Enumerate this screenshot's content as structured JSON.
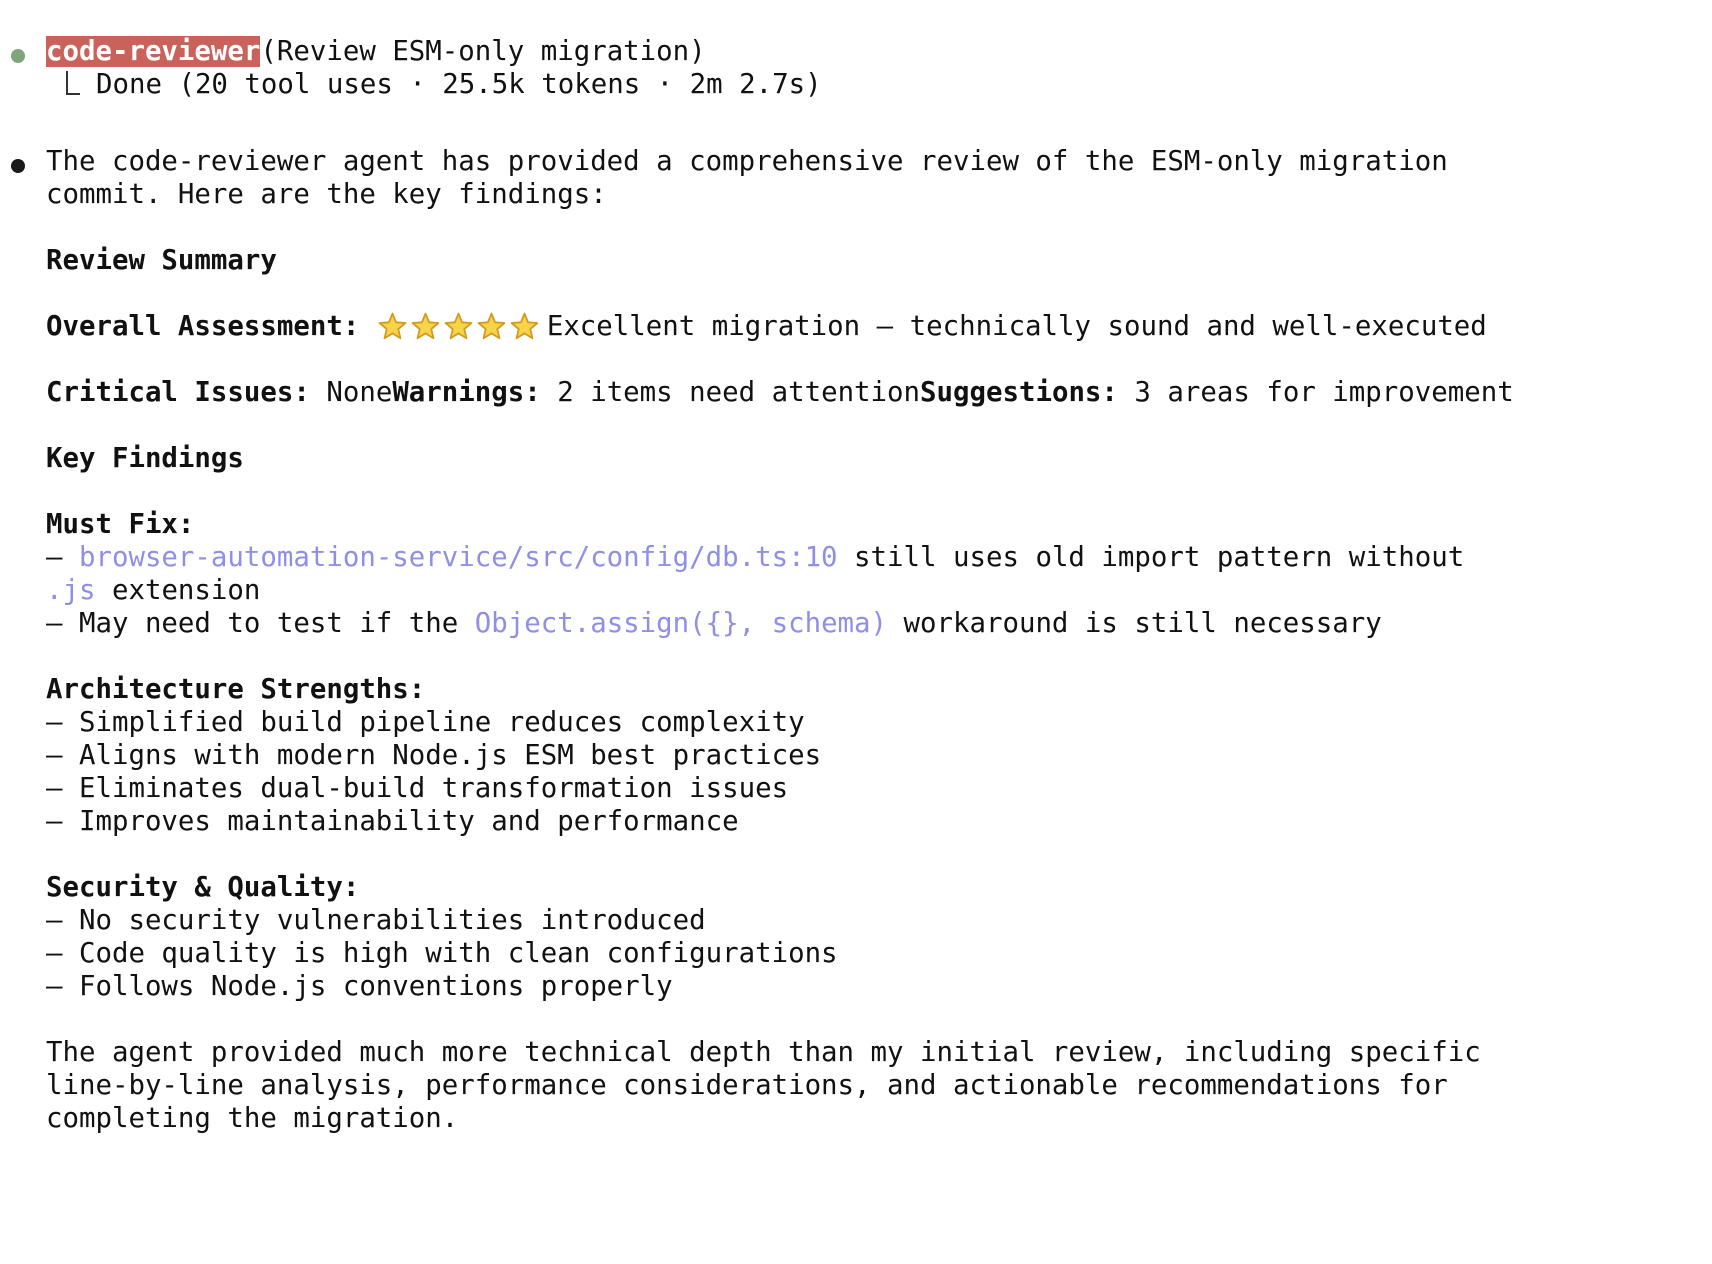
{
  "task": {
    "agent_name": "code-reviewer",
    "description": "(Review ESM-only migration)",
    "status": "Done (20 tool uses · 25.5k tokens · 2m 2.7s)"
  },
  "response": {
    "intro_line1": "The code-reviewer agent has provided a comprehensive review of the ESM-only migration",
    "intro_line2": "commit. Here are the key findings:",
    "review_summary_heading": "Review Summary",
    "overall_label": "Overall Assessment:",
    "overall_rating": 5,
    "overall_max": 5,
    "overall_text": "Excellent migration – technically sound and well-executed",
    "critical_label": "Critical Issues:",
    "critical_value": " None",
    "warnings_label": "Warnings:",
    "warnings_value": " 2 items need attention",
    "suggestions_label": "Suggestions:",
    "suggestions_value": " 3 areas for improvement",
    "key_findings_heading": "Key Findings",
    "must_fix": {
      "heading": "Must Fix:",
      "item1_prefix": "– ",
      "item1_path": "browser-automation-service/src/config/db.ts:10",
      "item1_text": " still uses old import pattern without",
      "item1_ext": ".js",
      "item1_text2": " extension",
      "item2_prefix": "– May need to test if the ",
      "item2_code": "Object.assign({}, schema)",
      "item2_text": " workaround is still necessary"
    },
    "architecture": {
      "heading": "Architecture Strengths:",
      "items": [
        "– Simplified build pipeline reduces complexity",
        "– Aligns with modern Node.js ESM best practices",
        "– Eliminates dual-build transformation issues",
        "– Improves maintainability and performance"
      ]
    },
    "security": {
      "heading": "Security & Quality:",
      "items": [
        "– No security vulnerabilities introduced",
        "– Code quality is high with clean configurations",
        "– Follows Node.js conventions properly"
      ]
    },
    "closing_line1": "The agent provided much more technical depth than my initial review, including specific",
    "closing_line2": "line-by-line analysis, performance considerations, and actionable recommendations for",
    "closing_line3": "completing the migration."
  },
  "colors": {
    "agent_badge_bg": "#c9625a",
    "success_bullet": "#7fa67a",
    "message_bullet": "#1a1a1a",
    "code_path": "#8f8fe8",
    "star_fill": "#f7d44a",
    "star_stroke": "#d39a1e"
  },
  "icons": {
    "status_bullet": "green-dot-icon",
    "message_bullet": "black-dot-icon",
    "tree_connector": "tree-branch-icon",
    "rating": "star-icon"
  }
}
